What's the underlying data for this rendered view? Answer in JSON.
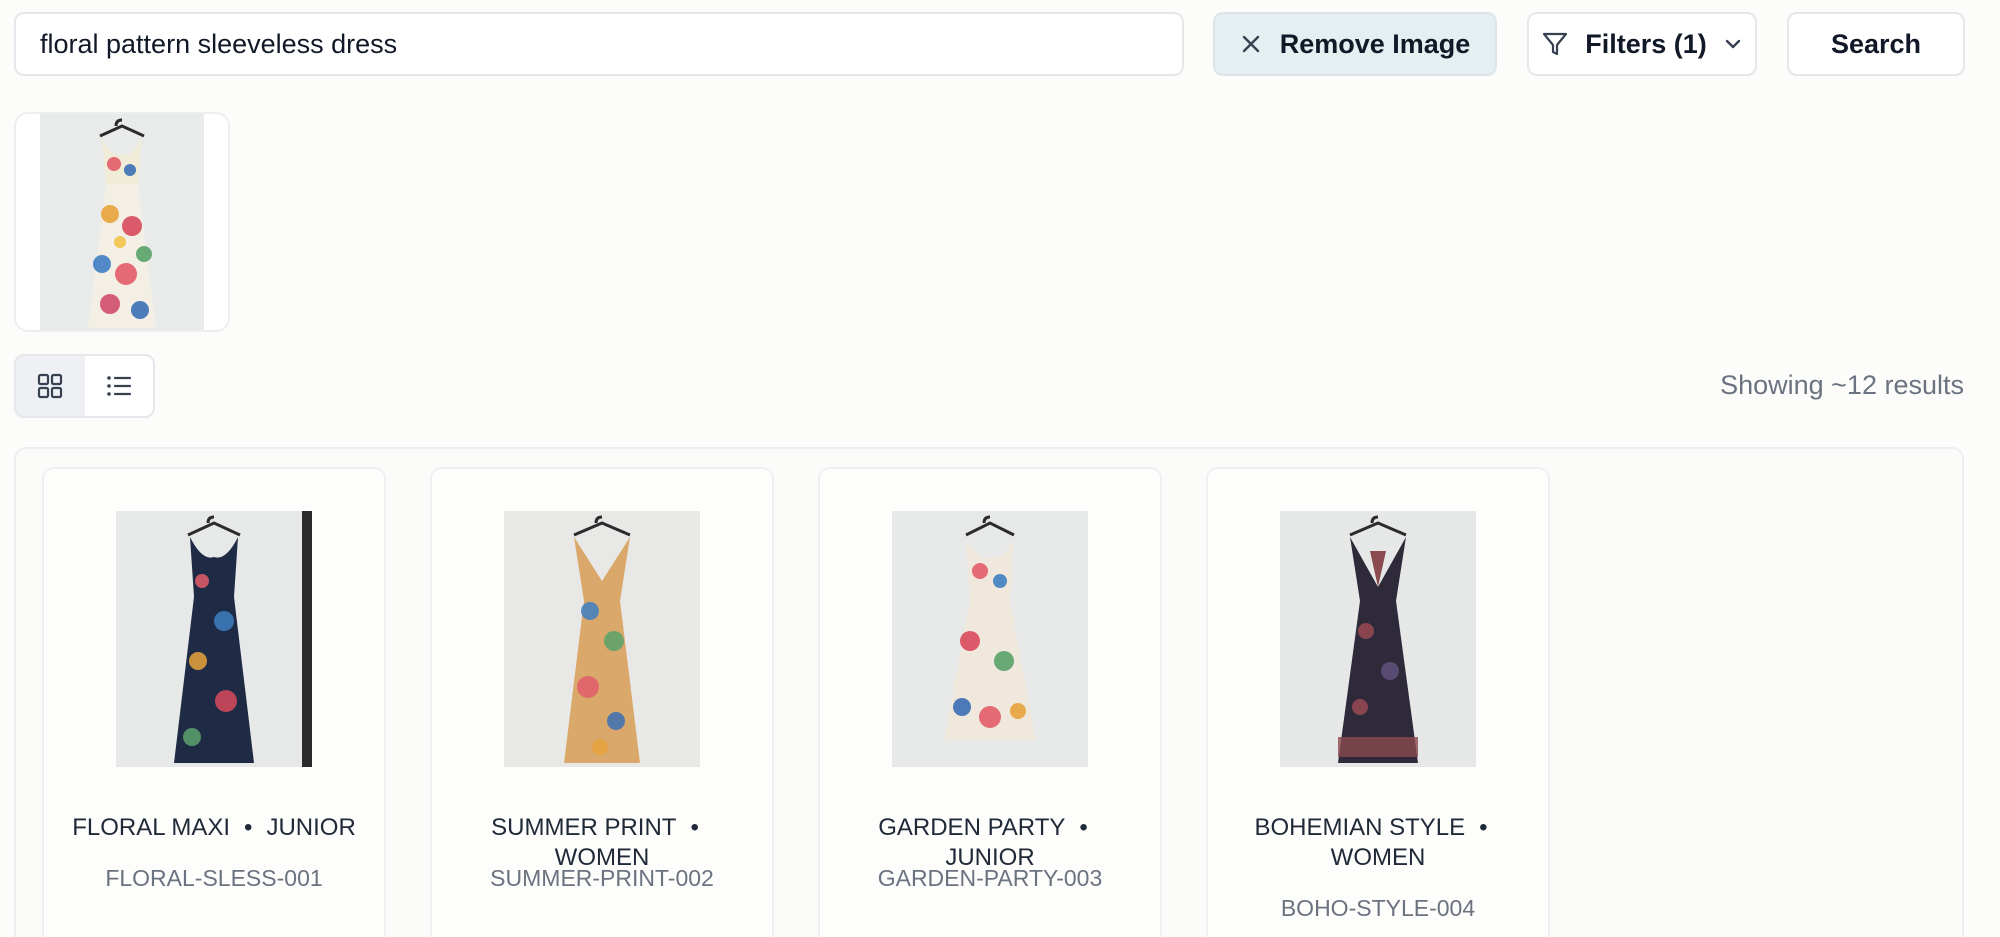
{
  "search": {
    "query": "floral pattern sleeveless dress"
  },
  "toolbar": {
    "remove_image_label": "Remove Image",
    "filters_label": "Filters (1)",
    "search_label": "Search"
  },
  "icons": {
    "remove": "close-icon",
    "filter": "funnel-icon",
    "dropdown": "chevron-down-icon",
    "grid_view": "grid-icon",
    "list_view": "list-icon"
  },
  "view": {
    "active": "grid"
  },
  "results": {
    "count_text": "Showing ~12 results",
    "items": [
      {
        "name": "FLORAL MAXI",
        "category": "JUNIOR",
        "sku": "FLORAL-SLESS-001",
        "dress_color": "#1f2a44"
      },
      {
        "name": "SUMMER PRINT",
        "category": "WOMEN",
        "sku": "SUMMER-PRINT-002",
        "dress_color": "#d9a86a"
      },
      {
        "name": "GARDEN PARTY",
        "category": "JUNIOR",
        "sku": "GARDEN-PARTY-003",
        "dress_color": "#e8d9c8"
      },
      {
        "name": "BOHEMIAN STYLE",
        "category": "WOMEN",
        "sku": "BOHO-STYLE-004",
        "dress_color": "#2e2a3a"
      }
    ]
  },
  "colors": {
    "background": "#fcfcfb",
    "remove_button_bg": "#e5eef0",
    "border": "#e5e7eb",
    "muted_text": "#6b7280"
  }
}
